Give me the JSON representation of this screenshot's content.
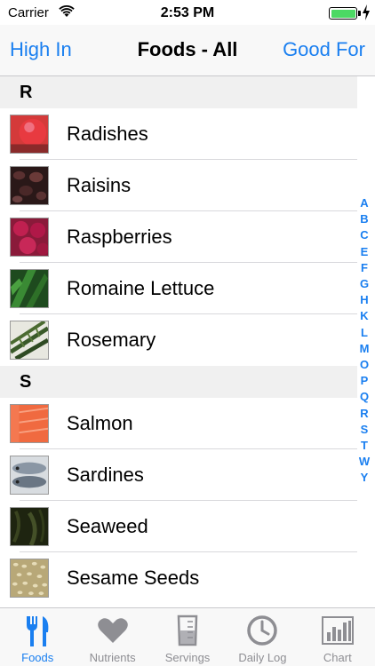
{
  "status_bar": {
    "carrier": "Carrier",
    "time": "2:53 PM"
  },
  "nav": {
    "left_button": "High In",
    "title": "Foods - All",
    "right_button": "Good For"
  },
  "sections": [
    {
      "letter": "R",
      "items": [
        {
          "name": "Radishes",
          "thumb": "radishes",
          "color": "#c8283a"
        },
        {
          "name": "Raisins",
          "thumb": "raisins",
          "color": "#3a2020"
        },
        {
          "name": "Raspberries",
          "thumb": "raspberries",
          "color": "#b0204a"
        },
        {
          "name": "Romaine Lettuce",
          "thumb": "romaine-lettuce",
          "color": "#2e6a2a"
        },
        {
          "name": "Rosemary",
          "thumb": "rosemary",
          "color": "#3c5a2a"
        }
      ]
    },
    {
      "letter": "S",
      "items": [
        {
          "name": "Salmon",
          "thumb": "salmon",
          "color": "#f06a40"
        },
        {
          "name": "Sardines",
          "thumb": "sardines",
          "color": "#8a96a4"
        },
        {
          "name": "Seaweed",
          "thumb": "seaweed",
          "color": "#2a3018"
        },
        {
          "name": "Sesame Seeds",
          "thumb": "sesame-seeds",
          "color": "#c8b890"
        }
      ]
    }
  ],
  "index_letters": [
    "A",
    "B",
    "C",
    "E",
    "F",
    "G",
    "H",
    "K",
    "L",
    "M",
    "O",
    "P",
    "Q",
    "R",
    "S",
    "T",
    "W",
    "Y"
  ],
  "tabs": [
    {
      "label": "Foods",
      "icon": "fork-knife-icon",
      "active": true
    },
    {
      "label": "Nutrients",
      "icon": "heart-icon",
      "active": false
    },
    {
      "label": "Servings",
      "icon": "measuring-cup-icon",
      "active": false
    },
    {
      "label": "Daily Log",
      "icon": "clock-icon",
      "active": false
    },
    {
      "label": "Chart",
      "icon": "bar-chart-icon",
      "active": false
    }
  ],
  "colors": {
    "accent": "#1a7ff0",
    "inactive": "#8e8e93",
    "battery": "#4cd964"
  }
}
